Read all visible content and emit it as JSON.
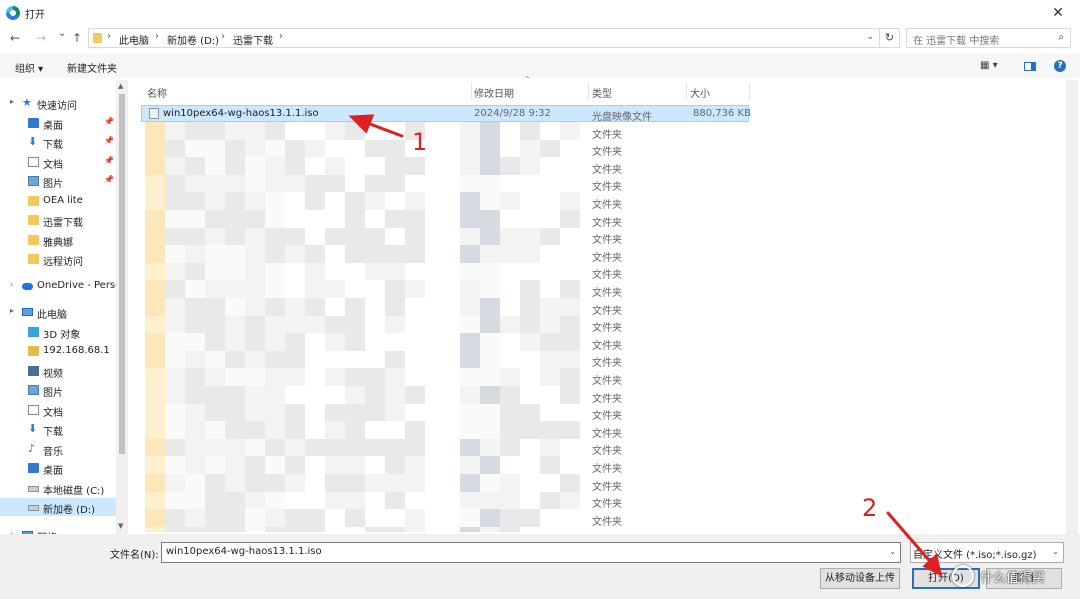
{
  "window": {
    "title": "打开",
    "close": "✕"
  },
  "nav": {
    "back": "←",
    "forward": "→",
    "recent": "⌄",
    "up": "↑",
    "breadcrumb": [
      "此电脑",
      "新加卷 (D:)",
      "迅雷下载"
    ],
    "sep": "›",
    "refresh": "↻",
    "search_placeholder": "在 迅雷下载 中搜索",
    "search_icon": "⌕"
  },
  "toolbar": {
    "organize": "组织 ▾",
    "new_folder": "新建文件夹",
    "view": "▦ ▾"
  },
  "sidebar": {
    "items": [
      {
        "label": "快速访问",
        "icon": "star-icon"
      },
      {
        "label": "桌面",
        "icon": "desktop-icon",
        "pinned": true
      },
      {
        "label": "下载",
        "icon": "download-icon",
        "pinned": true
      },
      {
        "label": "文档",
        "icon": "document-icon",
        "pinned": true
      },
      {
        "label": "图片",
        "icon": "picture-icon",
        "pinned": true
      },
      {
        "label": "OEA lite",
        "icon": "folder-icon"
      },
      {
        "label": "迅雷下载",
        "icon": "folder-icon"
      },
      {
        "label": "雅典娜",
        "icon": "folder-icon"
      },
      {
        "label": "远程访问",
        "icon": "folder-icon"
      },
      {
        "label": "OneDrive - Perso",
        "icon": "onedrive-icon"
      },
      {
        "label": "此电脑",
        "icon": "pc-icon"
      },
      {
        "label": "3D 对象",
        "icon": "3d-objects-icon"
      },
      {
        "label": "192.168.68.1",
        "icon": "network-drive-icon"
      },
      {
        "label": "视频",
        "icon": "video-icon"
      },
      {
        "label": "图片",
        "icon": "picture-icon"
      },
      {
        "label": "文档",
        "icon": "document-icon"
      },
      {
        "label": "下载",
        "icon": "download-icon"
      },
      {
        "label": "音乐",
        "icon": "music-icon"
      },
      {
        "label": "桌面",
        "icon": "desktop-icon"
      },
      {
        "label": "本地磁盘 (C:)",
        "icon": "drive-icon"
      },
      {
        "label": "新加卷 (D:)",
        "icon": "drive-icon"
      },
      {
        "label": "网络",
        "icon": "network-icon"
      }
    ]
  },
  "columns": {
    "name": "名称",
    "date": "修改日期",
    "type": "类型",
    "size": "大小"
  },
  "files": [
    {
      "name": "win10pex64-wg-haos13.1.1.iso",
      "date": "2024/9/28 9:32",
      "type": "光盘映像文件",
      "size": "880,736 KB",
      "selected": true,
      "kind": "iso"
    },
    {
      "name": "home-assistant-fun-ser-main",
      "date": "2024/9/26 9:00",
      "type": "文件夹",
      "size": "",
      "kind": "folder"
    },
    {
      "name": "",
      "date": "",
      "type": "文件夹",
      "size": "",
      "kind": "folder"
    },
    {
      "name": "",
      "date": "",
      "type": "文件夹",
      "size": "",
      "kind": "folder"
    },
    {
      "name": "",
      "date": "",
      "type": "文件夹",
      "size": "",
      "kind": "folder"
    },
    {
      "name": "",
      "date": "",
      "type": "文件夹",
      "size": "",
      "kind": "folder"
    },
    {
      "name": "",
      "date": "",
      "type": "文件夹",
      "size": "",
      "kind": "folder"
    },
    {
      "name": "",
      "date": "",
      "type": "文件夹",
      "size": "",
      "kind": "folder"
    },
    {
      "name": "",
      "date": "",
      "type": "文件夹",
      "size": "",
      "kind": "folder"
    },
    {
      "name": "",
      "date": "",
      "type": "文件夹",
      "size": "",
      "kind": "folder"
    },
    {
      "name": "",
      "date": "",
      "type": "文件夹",
      "size": "",
      "kind": "folder"
    },
    {
      "name": "",
      "date": "",
      "type": "文件夹",
      "size": "",
      "kind": "folder"
    },
    {
      "name": "",
      "date": "",
      "type": "文件夹",
      "size": "",
      "kind": "folder"
    },
    {
      "name": "",
      "date": "",
      "type": "文件夹",
      "size": "",
      "kind": "folder"
    },
    {
      "name": "",
      "date": "",
      "type": "文件夹",
      "size": "",
      "kind": "folder"
    },
    {
      "name": "",
      "date": "",
      "type": "文件夹",
      "size": "",
      "kind": "folder"
    },
    {
      "name": "",
      "date": "",
      "type": "文件夹",
      "size": "",
      "kind": "folder"
    },
    {
      "name": "",
      "date": "",
      "type": "文件夹",
      "size": "",
      "kind": "folder"
    },
    {
      "name": "",
      "date": "",
      "type": "文件夹",
      "size": "",
      "kind": "folder"
    },
    {
      "name": "",
      "date": "",
      "type": "文件夹",
      "size": "",
      "kind": "folder"
    },
    {
      "name": "",
      "date": "",
      "type": "文件夹",
      "size": "",
      "kind": "folder"
    },
    {
      "name": "",
      "date": "",
      "type": "文件夹",
      "size": "",
      "kind": "folder"
    },
    {
      "name": "",
      "date": "",
      "type": "文件夹",
      "size": "",
      "kind": "folder"
    },
    {
      "name": "",
      "date": "",
      "type": "文件夹",
      "size": "",
      "kind": "folder"
    },
    {
      "name": "",
      "date": "",
      "type": "文件夹",
      "size": "",
      "kind": "folder"
    }
  ],
  "bottom": {
    "filename_label": "文件名(N):",
    "filename_value": "win10pex64-wg-haos13.1.1.iso",
    "filter_value": "自定义文件 (*.iso;*.iso.gz)",
    "upload_label": "从移动设备上传",
    "open_label": "打开(O)",
    "cancel_label": "取消"
  },
  "annotations": {
    "step1": "1",
    "step2": "2"
  },
  "watermark": {
    "text": "什么值得买"
  },
  "colors": {
    "selection": "#cce8ff",
    "accent": "#2a6ebd",
    "annotation": "#e02020"
  }
}
